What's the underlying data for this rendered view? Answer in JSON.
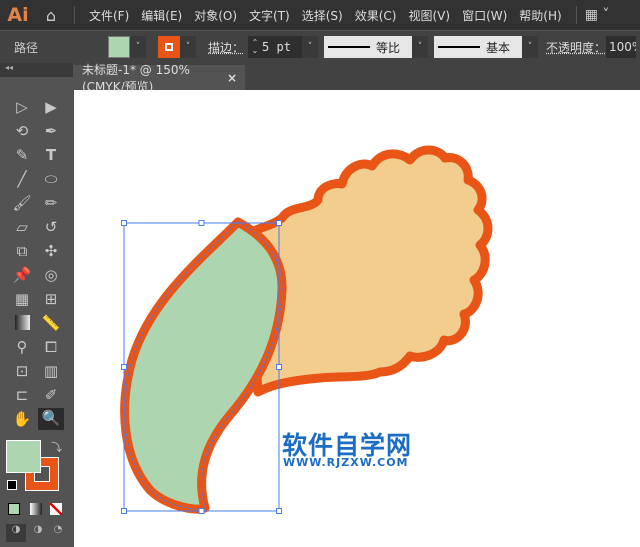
{
  "app": {
    "logo": "Ai"
  },
  "menu": [
    "文件(F)",
    "编辑(E)",
    "对象(O)",
    "文字(T)",
    "选择(S)",
    "效果(C)",
    "视图(V)",
    "窗口(W)",
    "帮助(H)"
  ],
  "control": {
    "object_type": "路径",
    "fill_color": "#acd5b0",
    "stroke_color": "#e85517",
    "stroke_label": "描边：",
    "stroke_weight": "5 pt",
    "profile1": "等比",
    "profile2": "基本",
    "opacity_label": "不透明度：",
    "opacity_value": "100%"
  },
  "document_tab": {
    "title": "未标题-1* @ 150% (CMYK/预览)",
    "close": "×"
  },
  "artwork": {
    "flower_fill": "#f2cd8d",
    "outline": "#e85517",
    "leaf_fill": "#acd5b0",
    "selection": "#4a7cf0"
  },
  "watermark": {
    "line1": "软件自学网",
    "line2": "WWW.RJZXW.COM"
  }
}
